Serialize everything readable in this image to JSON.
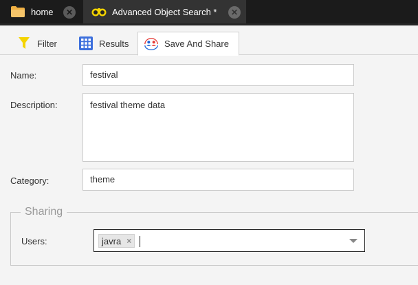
{
  "top_tabs": [
    {
      "label": "home",
      "icon": "folder-icon"
    },
    {
      "label": "Advanced Object Search *",
      "icon": "binoculars-icon"
    }
  ],
  "inner_tabs": [
    {
      "label": "Filter",
      "icon": "filter-icon"
    },
    {
      "label": "Results",
      "icon": "grid-icon"
    },
    {
      "label": "Save And Share",
      "icon": "share-users-icon",
      "active": true
    }
  ],
  "form": {
    "name_label": "Name:",
    "name_value": "festival",
    "description_label": "Description:",
    "description_value": "festival theme data",
    "category_label": "Category:",
    "category_value": "theme"
  },
  "sharing": {
    "legend": "Sharing",
    "users_label": "Users:",
    "selected_users": [
      "javra"
    ],
    "remove_symbol": "×"
  },
  "colors": {
    "topbar": "#1b1b1b",
    "active_top_tab": "#333333",
    "folder": "#f0b043",
    "filter": "#f5d400",
    "grid": "#3c6fdc",
    "share_red": "#e53935",
    "share_blue": "#1e63d6"
  }
}
